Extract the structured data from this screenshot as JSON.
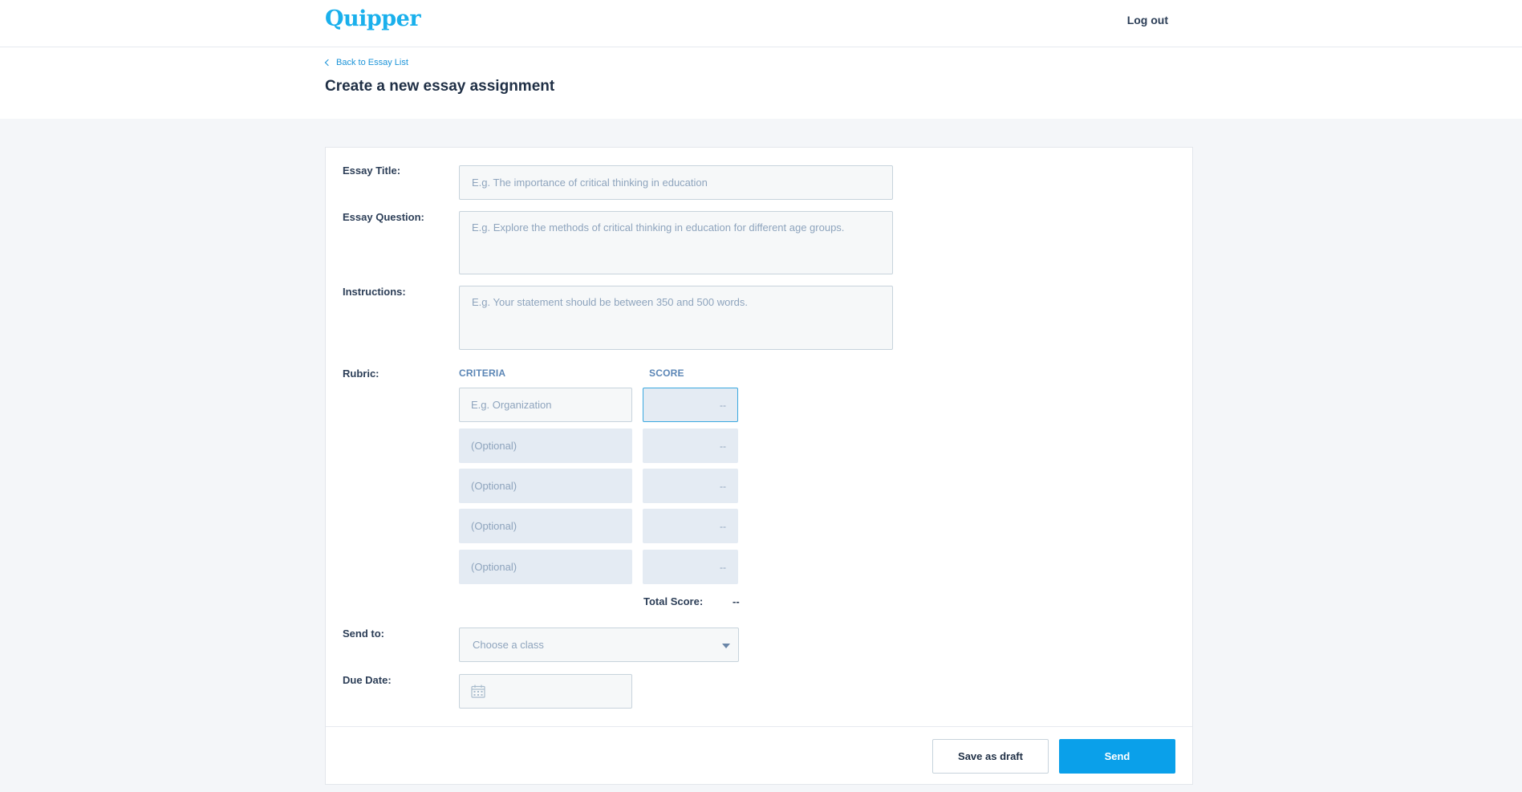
{
  "topbar": {
    "logo_text": "Quipper",
    "logout_label": "Log out"
  },
  "header": {
    "back_link_label": "Back to Essay List",
    "page_title": "Create a new essay assignment"
  },
  "form": {
    "essay_title": {
      "label": "Essay Title:",
      "value": "",
      "placeholder": "E.g. The importance of critical thinking in education"
    },
    "essay_question": {
      "label": "Essay Question:",
      "value": "",
      "placeholder": "E.g. Explore the methods of critical thinking in education for different age groups."
    },
    "instructions": {
      "label": "Instructions:",
      "value": "",
      "placeholder": "E.g. Your statement should be between 350 and 500 words."
    },
    "rubric": {
      "label": "Rubric:",
      "criteria_header": "CRITERIA",
      "score_header": "SCORE",
      "rows": [
        {
          "criteria_placeholder": "E.g. Organization",
          "score_placeholder": "--"
        },
        {
          "criteria_placeholder": "(Optional)",
          "score_placeholder": "--"
        },
        {
          "criteria_placeholder": "(Optional)",
          "score_placeholder": "--"
        },
        {
          "criteria_placeholder": "(Optional)",
          "score_placeholder": "--"
        },
        {
          "criteria_placeholder": "(Optional)",
          "score_placeholder": "--"
        }
      ],
      "total_label": "Total Score:",
      "total_value": "--"
    },
    "send_to": {
      "label": "Send to:",
      "selected": "Choose a class",
      "icon": "chevron-down-icon"
    },
    "due_date": {
      "label": "Due Date:",
      "value": "",
      "icon": "calendar-icon"
    }
  },
  "actions": {
    "save_draft_label": "Save as draft",
    "send_label": "Send"
  },
  "colors": {
    "brand": "#1ab0ec",
    "primary_button": "#0aa0ea",
    "link": "#1a93d8",
    "field_background": "#f6f8f9",
    "rubric_background": "#e4ebf3"
  }
}
